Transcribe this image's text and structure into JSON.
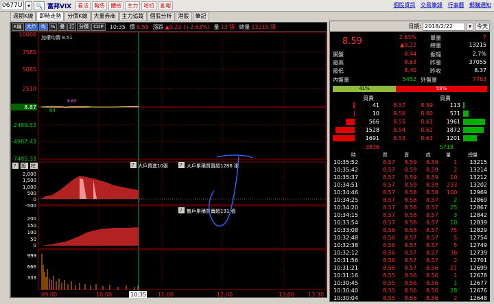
{
  "toolbar": {
    "symbol": "0677U",
    "name": "富邦VIX",
    "buttons": [
      "看法",
      "報告",
      "體檢",
      "主力",
      "哈拉",
      "亂報"
    ],
    "links": [
      "個股資訊",
      "交易筆錄",
      "行事曆",
      "郵購通知"
    ]
  },
  "tabs": [
    "週期K線",
    "即時走勢",
    "分價K線",
    "大量券商",
    "主力追蹤",
    "個股分析",
    "港股",
    "筆記"
  ],
  "active_tab": 1,
  "chart_bar": {
    "modes": [
      "K線",
      "大戶",
      "均",
      "%",
      "疊",
      "訂",
      "分價",
      "CDP"
    ],
    "time": "10:35",
    "price_label": "價",
    "price": "8.59",
    "change_label": "漲跌",
    "change": "▲0.22 (+2.63%)",
    "vol_label": "量",
    "vol": "13 張",
    "total_label": "總量",
    "total": "13215 張"
  },
  "price_panel": {
    "avg_label": "加權均價 8.51",
    "y_ticks": [
      "10000",
      "7585",
      "5085",
      "2510",
      "8.87",
      "-2489.53",
      "-4987.43",
      "-7485.33"
    ],
    "annot_84": "84",
    "annot_863": "8.63",
    "limit_top": "10000"
  },
  "flow_panel": {
    "toolbar": [
      "?",
      "設",
      "柱"
    ],
    "label1": "大戶買進10張",
    "label2": "大戶累積買賣超1286 張",
    "y_ticks": [
      "2,000",
      "1,500",
      "1,000",
      "500",
      "0",
      "-500"
    ]
  },
  "flow2_panel": {
    "label": "散戶累積買賣超191 張",
    "y_ticks": [
      "200",
      "150",
      "100",
      "50",
      "0",
      "-50"
    ]
  },
  "vol_panel": {
    "y_ticks": [
      "999",
      "666",
      "333"
    ]
  },
  "x_axis": [
    "09:00",
    "10:00",
    "10:35",
    "11:00",
    "12:00",
    "13:00",
    "13:30"
  ],
  "chart_data": {
    "type": "line",
    "x_range": [
      "09:00",
      "13:30"
    ],
    "price_series": {
      "name": "價",
      "last": 8.59,
      "avg": 8.51
    },
    "big_holder_cum": {
      "name": "大戶累積買賣超",
      "last": 1286
    },
    "retail_cum": {
      "name": "散戶累積買賣超",
      "last": 191
    }
  },
  "right": {
    "date_label": "日期:",
    "date": "2018/2/22",
    "today_btn": "今天",
    "price": "8.59",
    "pct": "2.63%",
    "chg": "▲0.22",
    "lot_label": "單量",
    "lot": "7",
    "vol_label": "總量",
    "vol": "13215",
    "open_l": "開盤",
    "open_v": "8.44",
    "high_l": "最高",
    "high_v": "8.63",
    "low_l": "最低",
    "low_v": "8.40",
    "amp_l": "振幅",
    "amp_v": "2.7%",
    "yvol_l": "昨量",
    "yvol_v": "37055",
    "yclose_l": "昨收",
    "yclose_v": "8.37",
    "inner_l": "內盤量",
    "inner_v": "5452",
    "outer_l": "外盤量",
    "outer_v": "7763",
    "inner_pct": "41%",
    "outer_pct": "59%",
    "bid_head": "買賣",
    "ask_head": "買賣",
    "book": [
      {
        "bq": "41",
        "bp": "8.57",
        "ap": "8.59",
        "aq": "113"
      },
      {
        "bq": "10",
        "bp": "8.56",
        "ap": "8.60",
        "aq": "571"
      },
      {
        "bq": "566",
        "bp": "8.55",
        "ap": "8.61",
        "aq": "1961"
      },
      {
        "bq": "1528",
        "bp": "8.54",
        "ap": "8.62",
        "aq": "1872"
      },
      {
        "bq": "1691",
        "bp": "8.53",
        "ap": "8.63",
        "aq": "1201"
      }
    ],
    "bid_total": "3836",
    "ask_total": "5718",
    "tick_headers": [
      "時",
      "買",
      "賣",
      "成",
      "量",
      "總量"
    ],
    "ticks": [
      [
        "10:35:52",
        "8.57",
        "8.59",
        "8.59",
        "1",
        "13215"
      ],
      [
        "10:35:42",
        "8.57",
        "8.59",
        "8.59",
        "2",
        "13214"
      ],
      [
        "10:35:37",
        "8.57",
        "8.59",
        "8.59",
        "10",
        "13212"
      ],
      [
        "10:34:51",
        "8.57",
        "8.59",
        "8.59",
        "233",
        "13202"
      ],
      [
        "10:34:46",
        "8.57",
        "8.58",
        "8.58",
        "100",
        "12969"
      ],
      [
        "10:34:25",
        "8.57",
        "8.58",
        "8.57",
        "2",
        "12869"
      ],
      [
        "10:34:20",
        "8.57",
        "8.58",
        "8.57",
        "25",
        "12867"
      ],
      [
        "10:34:15",
        "8.57",
        "8.58",
        "8.57",
        "3",
        "12842"
      ],
      [
        "10:33:54",
        "8.57",
        "8.58",
        "8.57",
        "10",
        "12839"
      ],
      [
        "10:33:08",
        "8.56",
        "8.58",
        "8.57",
        "75",
        "12829"
      ],
      [
        "10:32:48",
        "8.56",
        "8.57",
        "8.57",
        "5",
        "12754"
      ],
      [
        "10:32:38",
        "8.56",
        "8.57",
        "8.57",
        "5",
        "12749"
      ],
      [
        "10:32:12",
        "8.56",
        "8.57",
        "8.57",
        "38",
        "12739"
      ],
      [
        "10:31:56",
        "8.56",
        "8.57",
        "8.57",
        "2",
        "12701"
      ],
      [
        "10:31:21",
        "8.56",
        "8.57",
        "8.56",
        "21",
        "12699"
      ],
      [
        "10:31:16",
        "8.55",
        "8.56",
        "8.56",
        "1",
        "12678"
      ],
      [
        "10:30:45",
        "8.55",
        "8.56",
        "8.56",
        "1",
        "12677"
      ],
      [
        "10:30:40",
        "8.55",
        "8.56",
        "8.56",
        "28",
        "12676"
      ],
      [
        "10:30:04",
        "8.55",
        "8.56",
        "8.56",
        "2",
        "12648"
      ]
    ]
  }
}
